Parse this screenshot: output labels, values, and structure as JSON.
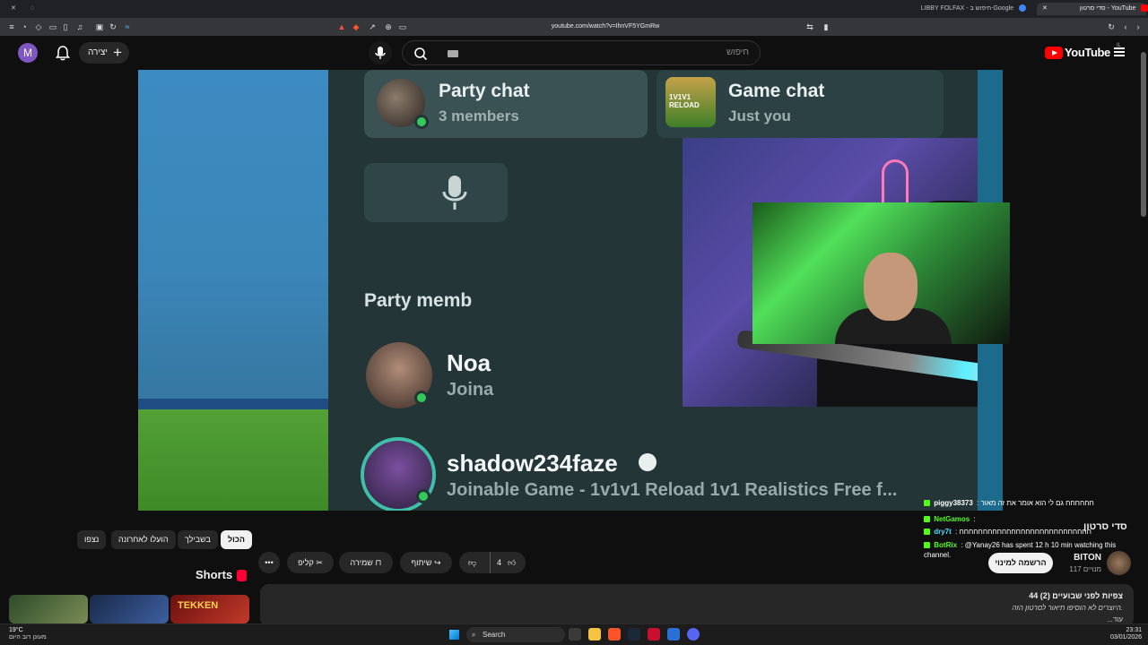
{
  "browser": {
    "tabs": [
      {
        "label": "סדי סרטון - YouTube",
        "active": true
      },
      {
        "label": "LIBBY FOLFAX - חיפוש ב-Google",
        "active": false
      }
    ],
    "url": "youtube.com/watch?v=IhnVF5YGmRw"
  },
  "header": {
    "avatar_letter": "M",
    "create_label": "יצירה",
    "search_placeholder": "חיפוש",
    "logo_text": "YouTube",
    "logo_superscript": "IL"
  },
  "video": {
    "party_chat_title": "Party chat",
    "party_chat_sub": "3 members",
    "game_chat_title": "Game chat",
    "game_chat_sub": "Just you",
    "members_heading": "Party memb",
    "member1_name": "Noa",
    "member1_sub": "Joina",
    "member2_name": "shadow234faze",
    "member2_sub": "Joinable Game - 1v1v1 Reload 1v1 Realistics Free f...",
    "game_thumb_text": "1V1V1 RELOAD"
  },
  "chat": [
    {
      "user": "piggy38373",
      "msg": ": חחחחחח גם לי הוא אומר את זה מאור",
      "color": "#ffffff"
    },
    {
      "user": "NetGamos",
      "msg": ":",
      "color": "#53fc18"
    },
    {
      "user": "dry7t",
      "msg": ": חחחחחחחחחחחחחחחחחחחחחחחחחחחח",
      "color": "#5dd8ff"
    },
    {
      "user": "BotRix",
      "msg": ": @Yanay26 has spent 12 h 10 min watching this",
      "color": "#53fc18"
    },
    {
      "user": "",
      "msg": "channel.",
      "color": "#ffffff"
    }
  ],
  "channel": {
    "overlay_title": "סדי סרטון",
    "name": "BITON",
    "subscribers": "117 מנויים",
    "subscribe_label": "הרשמה למינוי"
  },
  "actions": {
    "likes": "4",
    "share": "שיתוף",
    "save": "שמירה",
    "clip": "קליפ",
    "more": "•••"
  },
  "filters": [
    {
      "label": "הכול",
      "active": true
    },
    {
      "label": "בשבילך",
      "active": false
    },
    {
      "label": "הועלו לאחרונה",
      "active": false
    },
    {
      "label": "נצפו",
      "active": false
    }
  ],
  "shorts": {
    "label": "Shorts",
    "thumb3_text": "TEKKEN"
  },
  "description": {
    "meta": "44 צפיות  לפני שבועיים (2)",
    "text": "היוצרים לא הוסיפו תיאור לסרטון הזה.",
    "more": "...עוד"
  },
  "taskbar": {
    "weather_temp": "19°C",
    "weather_desc": "מעונן רוב היום",
    "search_label": "Search",
    "time": "23:31",
    "date": "03/01/2026"
  }
}
